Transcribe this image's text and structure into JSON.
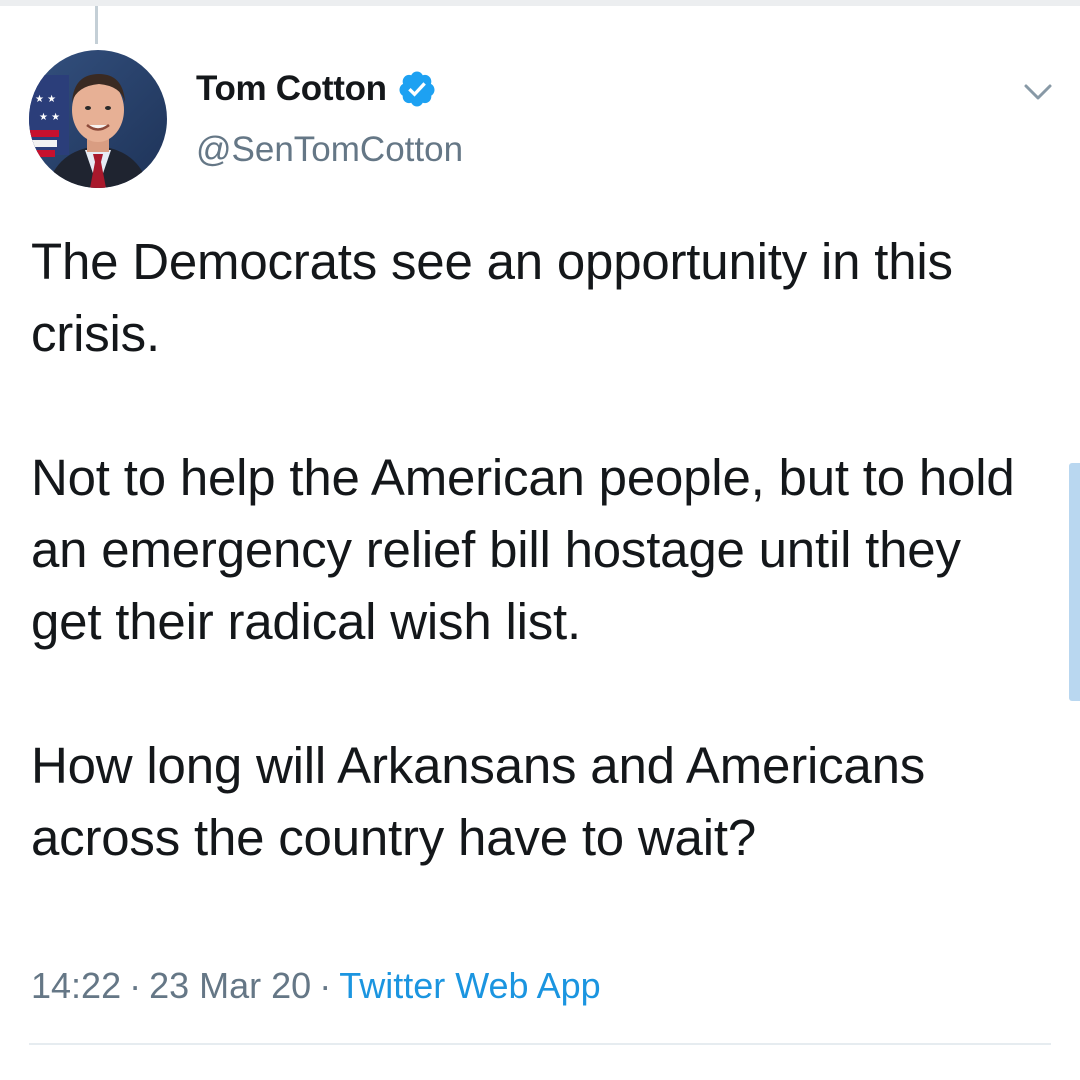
{
  "tweet": {
    "author": {
      "display_name": "Tom Cotton",
      "handle": "@SenTomCotton",
      "verified_icon": "verified-badge-icon",
      "avatar_icon": "avatar-photo"
    },
    "paragraphs": [
      "The Democrats see an opportunity in this crisis.",
      "Not to help the American people, but to hold an emergency relief bill hostage until they get their radical wish list.",
      "How long will Arkansans and Americans across the country have to wait?"
    ],
    "time": "14:22",
    "separator": "·",
    "date": "23 Mar 20",
    "source": "Twitter Web App",
    "menu_icon": "chevron-down-icon"
  },
  "colors": {
    "text_primary": "#14171a",
    "text_secondary": "#657786",
    "link": "#1b95e0",
    "verified": "#1da1f2",
    "divider": "#e6ecf0"
  }
}
